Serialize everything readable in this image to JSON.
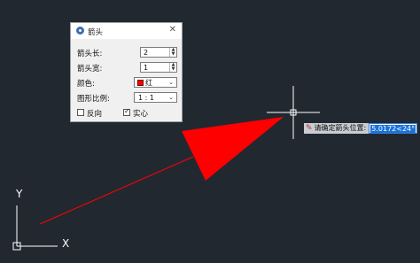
{
  "dialog": {
    "title": "箭头",
    "rows": {
      "length_label": "箭头长:",
      "length_value": "2",
      "width_label": "箭头宽:",
      "width_value": "1",
      "color_label": "颜色:",
      "color_value": "红",
      "ratio_label": "图形比例:",
      "ratio_value": "1 : 1"
    },
    "checkboxes": {
      "reverse_label": "反向",
      "reverse_checked": false,
      "solid_label": "实心",
      "solid_checked": true
    },
    "close_glyph": "✕",
    "check_glyph": "✓",
    "spin_up_glyph": "▲",
    "spin_down_glyph": "▼",
    "dropdown_glyph": "⌄"
  },
  "prompt": {
    "label": "请确定箭头位置:",
    "value": "5.0172<24°"
  },
  "ucs": {
    "x_label": "X",
    "y_label": "Y"
  },
  "colors": {
    "canvas_bg": "#212830",
    "arrow": "#ff0000",
    "crosshair": "#ffffff",
    "ucs": "#ffffff"
  }
}
